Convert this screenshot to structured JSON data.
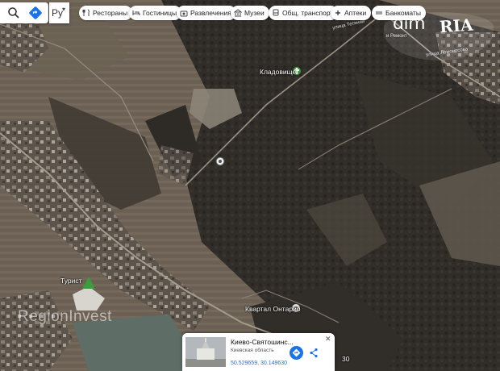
{
  "search": {
    "icon": "search-icon",
    "directions_icon": "directions-icon"
  },
  "language": {
    "label": "Ру",
    "caret": "▾"
  },
  "chips": [
    {
      "label": "Рестораны",
      "icon": "fork-knife-icon"
    },
    {
      "label": "Гостиницы",
      "icon": "bed-icon"
    },
    {
      "label": "Развлечения",
      "icon": "camera-icon"
    },
    {
      "label": "Музеи",
      "icon": "museum-icon"
    },
    {
      "label": "Общ. транспорт",
      "icon": "bus-icon"
    },
    {
      "label": "Аптеки",
      "icon": "pharmacy-icon"
    },
    {
      "label": "Банкоматы",
      "icon": "cash-icon"
    }
  ],
  "logo": {
    "left": "dim",
    "right": "RIA"
  },
  "map_labels": {
    "cemetery": "Кладовище",
    "kvartal": "Квартал Онтарио",
    "turist": "Турист",
    "house_number": "30",
    "street_1": "улица Тетянии",
    "street_2": "и Ремонт",
    "street_3": "улица Ломоносова"
  },
  "watermark": "RegionInvest",
  "card": {
    "title": "Киево-Святошинс...",
    "region": "Киевская область",
    "coordinates": "50.529659, 30.149630",
    "close_label": "✕"
  },
  "colors": {
    "map_link": "#1a73e8",
    "marker_green": "#3c9c3c"
  }
}
